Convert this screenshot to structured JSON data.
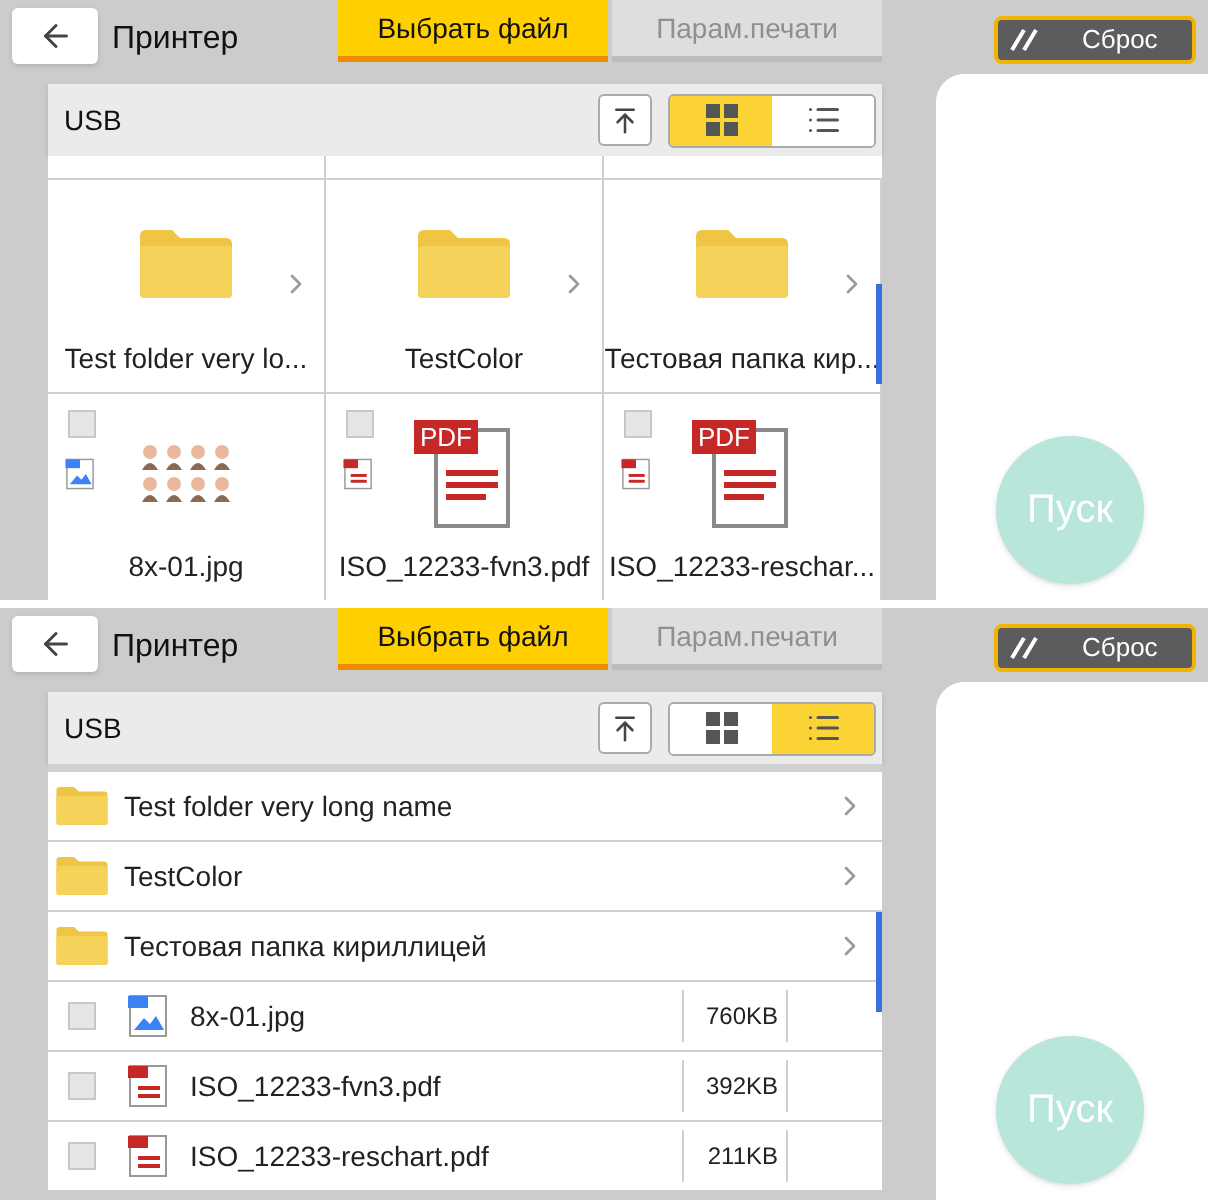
{
  "panels": [
    {
      "kind": "grid",
      "title": "Принтер",
      "tabs": [
        {
          "label": "Выбрать файл",
          "selected": true,
          "disabled": false
        },
        {
          "label": "Парам.печати",
          "selected": false,
          "disabled": true
        }
      ],
      "reset": "Сброс",
      "location": "USB",
      "toggle": [
        {
          "kind": "grid",
          "selected": true
        },
        {
          "kind": "list",
          "selected": false
        }
      ],
      "start": "Пуск",
      "items": [
        {
          "kind": "folder",
          "name": "Test folder very lo..."
        },
        {
          "kind": "folder",
          "name": "TestColor"
        },
        {
          "kind": "folder",
          "name": "Тестовая папка кир..."
        },
        {
          "kind": "jpg",
          "name": "8x-01.jpg",
          "checked": false
        },
        {
          "kind": "pdf",
          "badge": "PDF",
          "name": "ISO_12233-fvn3.pdf",
          "checked": false
        },
        {
          "kind": "pdf",
          "badge": "PDF",
          "name": "ISO_12233-reschar...",
          "checked": false
        }
      ]
    },
    {
      "kind": "list",
      "title": "Принтер",
      "tabs": [
        {
          "label": "Выбрать файл",
          "selected": true,
          "disabled": false
        },
        {
          "label": "Парам.печати",
          "selected": false,
          "disabled": true
        }
      ],
      "reset": "Сброс",
      "location": "USB",
      "toggle": [
        {
          "kind": "grid",
          "selected": false
        },
        {
          "kind": "list",
          "selected": true
        }
      ],
      "start": "Пуск",
      "items": [
        {
          "kind": "folder",
          "name": "Test folder very long name"
        },
        {
          "kind": "folder",
          "name": "TestColor"
        },
        {
          "kind": "folder",
          "name": "Тестовая папка кириллицей"
        },
        {
          "kind": "jpg",
          "name": "8x-01.jpg",
          "size": "760KB",
          "checked": false
        },
        {
          "kind": "pdf",
          "name": "ISO_12233-fvn3.pdf",
          "size": "392KB",
          "checked": false
        },
        {
          "kind": "pdf",
          "name": "ISO_12233-reschart.pdf",
          "size": "211KB",
          "checked": false
        }
      ]
    }
  ]
}
